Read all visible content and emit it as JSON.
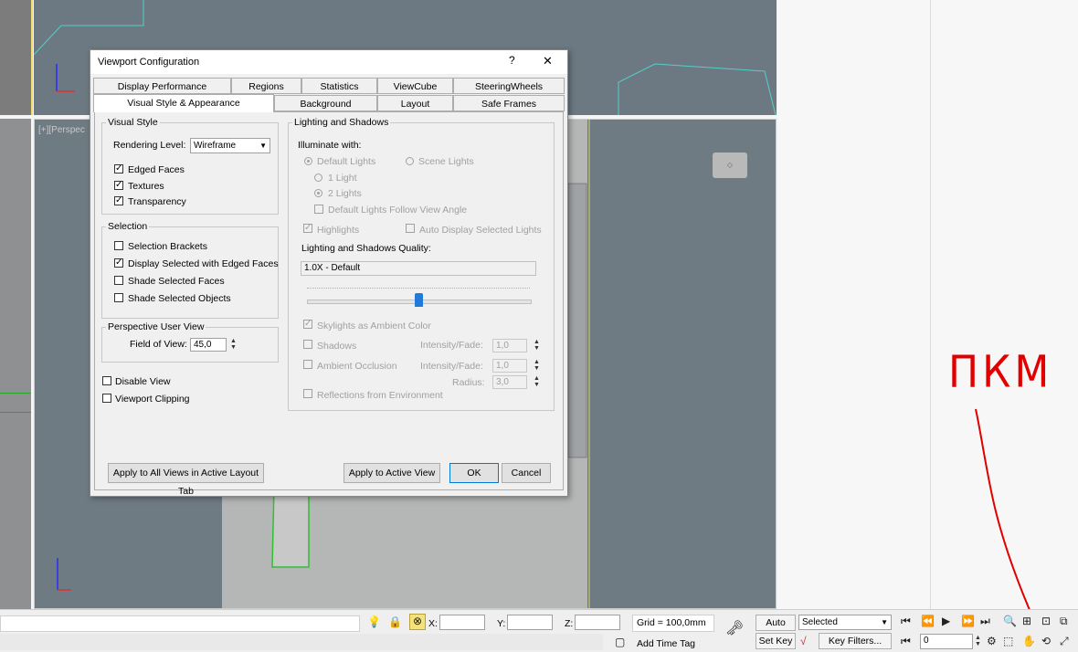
{
  "viewport": {
    "perspective_label": "[+][Perspec"
  },
  "dialog": {
    "title": "Viewport Configuration",
    "help_btn": "?",
    "close_btn": "✕",
    "tabs_row1": [
      "Display Performance",
      "Regions",
      "Statistics",
      "ViewCube",
      "SteeringWheels"
    ],
    "tabs_row2": [
      "Visual Style & Appearance",
      "Background",
      "Layout",
      "Safe Frames"
    ],
    "active_tab": "Visual Style & Appearance",
    "visual_style": {
      "title": "Visual Style",
      "rendering_level_label": "Rendering Level:",
      "rendering_level_value": "Wireframe",
      "edged_faces": {
        "label": "Edged Faces",
        "checked": true
      },
      "textures": {
        "label": "Textures",
        "checked": true
      },
      "transparency": {
        "label": "Transparency",
        "checked": true
      }
    },
    "selection": {
      "title": "Selection",
      "selection_brackets": {
        "label": "Selection Brackets",
        "checked": false
      },
      "display_selected_edged": {
        "label": "Display Selected with Edged Faces",
        "checked": true
      },
      "shade_selected_faces": {
        "label": "Shade Selected Faces",
        "checked": false
      },
      "shade_selected_objects": {
        "label": "Shade Selected Objects",
        "checked": false
      }
    },
    "perspective": {
      "title": "Perspective User View",
      "fov_label": "Field of View:",
      "fov_value": "45,0"
    },
    "disable_view": {
      "label": "Disable View",
      "checked": false
    },
    "viewport_clipping": {
      "label": "Viewport Clipping",
      "checked": false
    },
    "lighting": {
      "title": "Lighting and Shadows",
      "illuminate_with": "Illuminate with:",
      "default_lights": "Default Lights",
      "scene_lights": "Scene Lights",
      "one_light": "1 Light",
      "two_lights": "2 Lights",
      "follow_view": "Default Lights Follow View Angle",
      "highlights": "Highlights",
      "auto_display": "Auto Display Selected Lights",
      "quality_label": "Lighting and Shadows Quality:",
      "quality_value": "1.0X - Default",
      "quality_slider": 0.5,
      "skylights": "Skylights as Ambient Color",
      "shadows": "Shadows",
      "intensity_fade_label": "Intensity/Fade:",
      "shadows_intensity": "1,0",
      "ambient_occlusion": "Ambient Occlusion",
      "ao_intensity": "1,0",
      "radius_label": "Radius:",
      "ao_radius": "3,0",
      "reflections": "Reflections from Environment"
    },
    "buttons": {
      "apply_all": "Apply to All Views in Active Layout Tab",
      "apply_active": "Apply to Active View",
      "ok": "OK",
      "cancel": "Cancel"
    }
  },
  "annotation": {
    "text": "ПКМ",
    "color": "#e00000"
  },
  "statusbar": {
    "x_label": "X:",
    "y_label": "Y:",
    "z_label": "Z:",
    "grid": "Grid = 100,0mm",
    "add_time_tag": "Add Time Tag",
    "auto_key": "Auto Key",
    "set_key": "Set Key",
    "selected": "Selected",
    "key_filters": "Key Filters...",
    "frame_value": "0"
  }
}
